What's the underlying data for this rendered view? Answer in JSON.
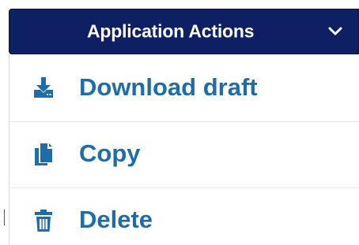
{
  "actions": {
    "label": "Application Actions",
    "background": "#0e1f63",
    "chevron_icon": "chevron-down-icon"
  },
  "menu": {
    "items": [
      {
        "label": "Download draft",
        "icon": "download-icon"
      },
      {
        "label": "Copy",
        "icon": "copy-icon"
      },
      {
        "label": "Delete",
        "icon": "trash-icon"
      }
    ],
    "text_color": "#1f6ca8"
  }
}
